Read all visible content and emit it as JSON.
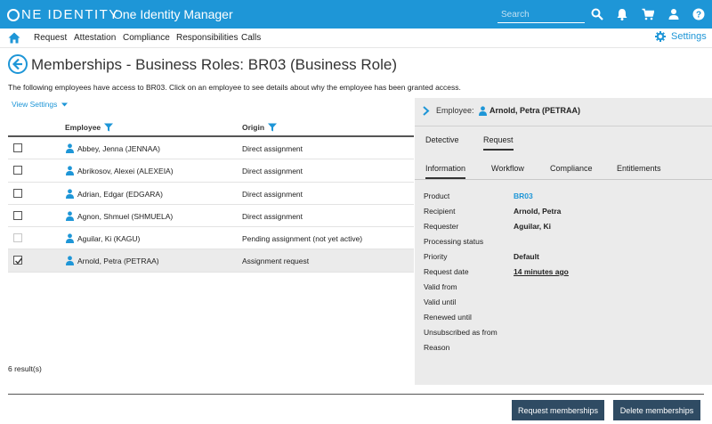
{
  "header": {
    "logo_text": "ONE IDENTITY",
    "logo_rest": "NE IDENTITY",
    "app_title": "One Identity Manager",
    "search_placeholder": "Search",
    "icons": [
      "search-icon",
      "bell-icon",
      "cart-icon",
      "user-icon",
      "help-icon"
    ]
  },
  "nav": {
    "items": [
      "Request",
      "Attestation",
      "Compliance",
      "Responsibilities",
      "Calls"
    ],
    "settings_label": "Settings"
  },
  "page": {
    "title": "Memberships - Business Roles: BR03 (Business Role)",
    "intro": "The following employees have access to BR03. Click on an employee to see details about why the employee has been granted access.",
    "view_settings": "View Settings"
  },
  "table": {
    "columns": [
      "Employee",
      "Origin"
    ],
    "rows": [
      {
        "employee": "Abbey, Jenna (JENNAA)",
        "origin": "Direct assignment",
        "checked": false,
        "disabled": false
      },
      {
        "employee": "Abrikosov, Alexei (ALEXEIA)",
        "origin": "Direct assignment",
        "checked": false,
        "disabled": false
      },
      {
        "employee": "Adrian, Edgar (EDGARA)",
        "origin": "Direct assignment",
        "checked": false,
        "disabled": false
      },
      {
        "employee": "Agnon, Shmuel (SHMUELA)",
        "origin": "Direct assignment",
        "checked": false,
        "disabled": false
      },
      {
        "employee": "Aguilar, Ki (KAGU)",
        "origin": "Pending assignment (not yet active)",
        "checked": false,
        "disabled": true
      },
      {
        "employee": "Arnold, Petra (PETRAA)",
        "origin": "Assignment request",
        "checked": true,
        "disabled": false
      }
    ],
    "results": "6 result(s)"
  },
  "panel": {
    "employee_label": "Employee:",
    "employee_name": "Arnold, Petra (PETRAA)",
    "tabs_top": [
      "Detective",
      "Request"
    ],
    "tabs_sub": [
      "Information",
      "Workflow",
      "Compliance",
      "Entitlements"
    ],
    "details": [
      {
        "label": "Product",
        "value": "BR03"
      },
      {
        "label": "Recipient",
        "value": "Arnold, Petra"
      },
      {
        "label": "Requester",
        "value": "Aguilar, Ki"
      },
      {
        "label": "Processing status",
        "value": ""
      },
      {
        "label": "Priority",
        "value": "Default"
      },
      {
        "label": "Request date",
        "value": "14 minutes ago"
      },
      {
        "label": "Valid from",
        "value": ""
      },
      {
        "label": "Valid until",
        "value": ""
      },
      {
        "label": "Renewed until",
        "value": ""
      },
      {
        "label": "Unsubscribed as from",
        "value": ""
      },
      {
        "label": "Reason",
        "value": ""
      }
    ]
  },
  "footer": {
    "request_button": "Request memberships",
    "delete_button": "Delete memberships"
  },
  "colors": {
    "brand": "#1e96d7",
    "button": "#2f4b63",
    "panel": "#ebebeb"
  }
}
